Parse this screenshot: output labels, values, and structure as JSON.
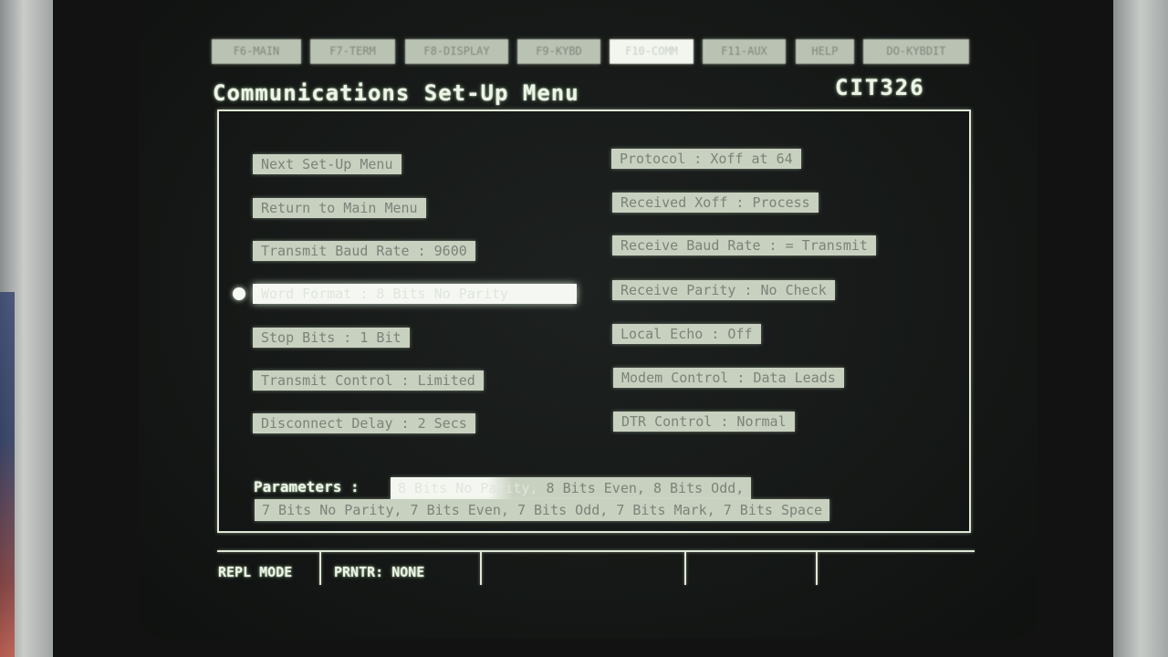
{
  "function_keys": [
    {
      "label": "F6-MAIN",
      "active": false
    },
    {
      "label": "F7-TERM",
      "active": false
    },
    {
      "label": "F8-DISPLAY",
      "active": false
    },
    {
      "label": "F9-KYBD",
      "active": false
    },
    {
      "label": "F10-COMM",
      "active": true
    },
    {
      "label": "F11-AUX",
      "active": false
    },
    {
      "label": "HELP",
      "active": false
    },
    {
      "label": "DO-KYBDIT",
      "active": false
    }
  ],
  "header": {
    "title": "Communications Set-Up Menu",
    "model": "CIT326"
  },
  "menu": {
    "left": [
      {
        "label": "Next Set-Up Menu"
      },
      {
        "label": "Return to Main Menu"
      },
      {
        "label": "Transmit Baud Rate : 9600"
      },
      {
        "label": "Word Format : 8 Bits No Parity",
        "selected": true
      },
      {
        "label": "Stop Bits : 1 Bit"
      },
      {
        "label": "Transmit Control : Limited"
      },
      {
        "label": "Disconnect Delay : 2 Secs"
      }
    ],
    "right": [
      {
        "label": "Protocol : Xoff at 64"
      },
      {
        "label": "Received Xoff : Process"
      },
      {
        "label": "Receive Baud Rate : = Transmit"
      },
      {
        "label": "Receive Parity : No Check"
      },
      {
        "label": "Local Echo : Off"
      },
      {
        "label": "Modem Control : Data Leads"
      },
      {
        "label": "DTR Control : Normal"
      }
    ]
  },
  "parameters": {
    "label": "Parameters :",
    "current": "8 Bits No Parity,",
    "line1_rest": " 8 Bits Even, 8 Bits Odd,",
    "line2": "7 Bits No Parity, 7 Bits Even, 7 Bits Odd, 7 Bits Mark, 7 Bits Space"
  },
  "status_bar": {
    "mode": "REPL MODE",
    "printer": "PRNTR: NONE"
  }
}
